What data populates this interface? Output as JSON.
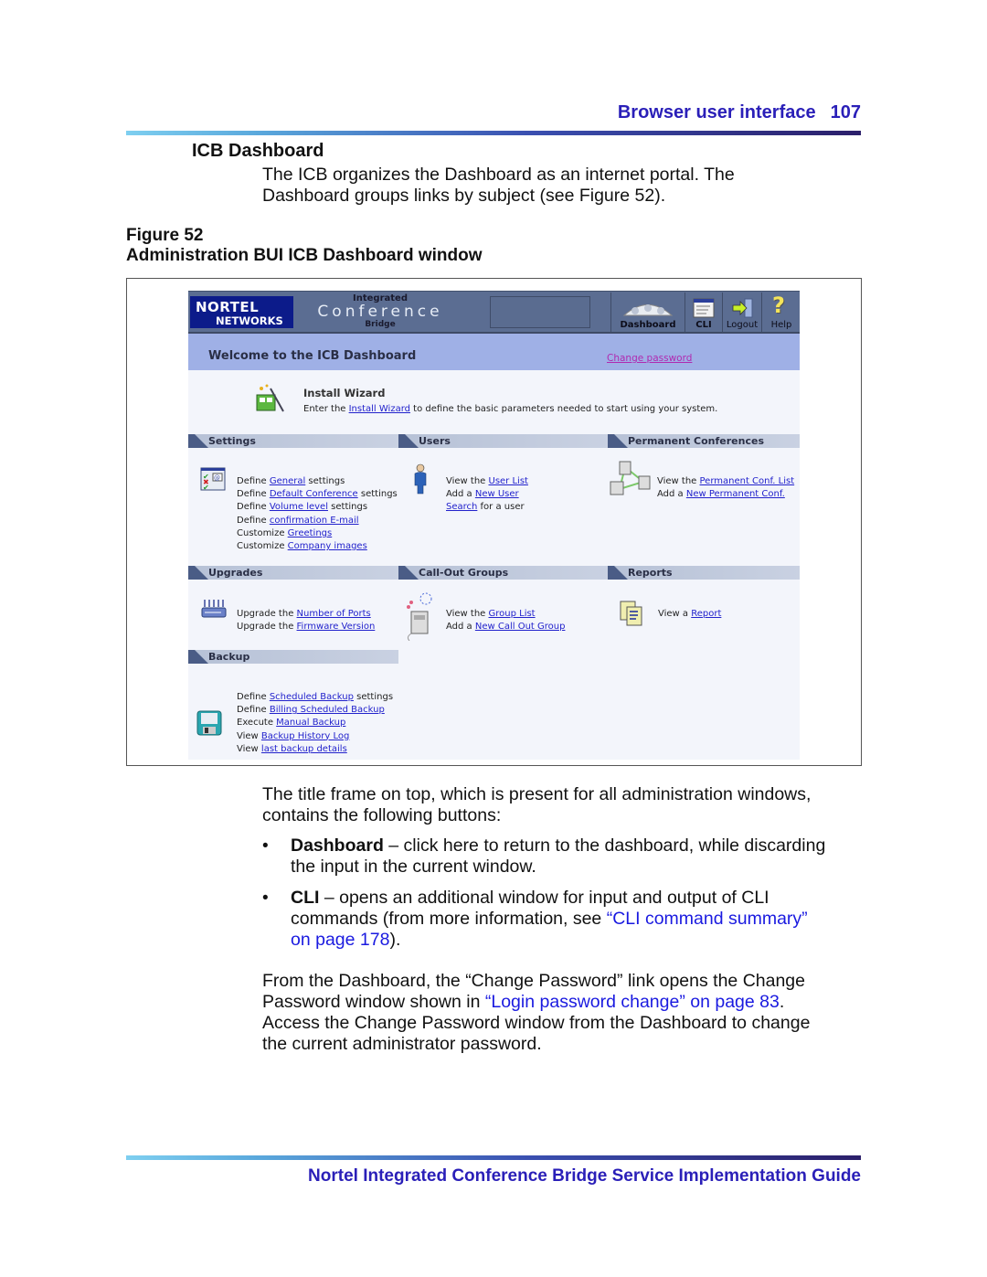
{
  "header": {
    "section": "Browser user interface",
    "page_number": "107"
  },
  "section_title": "ICB Dashboard",
  "intro_lines": [
    "The ICB organizes the Dashboard as an internet portal. The",
    "Dashboard groups links by subject (see Figure 52)."
  ],
  "figure": {
    "number": "Figure 52",
    "caption": "Administration BUI ICB Dashboard window"
  },
  "app": {
    "logo": {
      "line1": "NORTEL",
      "line2": "NETWORKS"
    },
    "product": {
      "line1": "Integrated",
      "line2": "Conference",
      "line3": "Bridge"
    },
    "toolbar": [
      {
        "label": "Dashboard",
        "icon": "dashboard-gauges-icon"
      },
      {
        "label": "CLI",
        "icon": "cli-window-icon"
      },
      {
        "label": "Logout",
        "icon": "logout-door-arrow-icon"
      },
      {
        "label": "Help",
        "icon": "help-question-icon"
      }
    ],
    "welcome": "Welcome to the ICB Dashboard",
    "change_password": "Change password",
    "wizard": {
      "title": "Install Wizard",
      "pre": "Enter the ",
      "link": "Install Wizard",
      "post": " to define the basic parameters needed to start using your system."
    },
    "sections": {
      "settings": {
        "title": "Settings",
        "items": [
          {
            "pre": "Define ",
            "link": "General",
            "post": " settings"
          },
          {
            "pre": "Define ",
            "link": "Default Conference",
            "post": " settings"
          },
          {
            "pre": "Define ",
            "link": "Volume level",
            "post": " settings"
          },
          {
            "pre": "Define ",
            "link": "confirmation E-mail",
            "post": ""
          },
          {
            "pre": "Customize ",
            "link": "Greetings",
            "post": ""
          },
          {
            "pre": "Customize ",
            "link": "Company images",
            "post": ""
          }
        ]
      },
      "users": {
        "title": "Users",
        "items": [
          {
            "pre": "View the ",
            "link": "User List",
            "post": ""
          },
          {
            "pre": "Add a ",
            "link": "New User",
            "post": ""
          },
          {
            "pre": "",
            "link": "Search",
            "post": " for a user"
          }
        ]
      },
      "permanent": {
        "title": "Permanent Conferences",
        "items": [
          {
            "pre": "View the ",
            "link": "Permanent Conf. List",
            "post": ""
          },
          {
            "pre": "Add a ",
            "link": "New Permanent Conf.",
            "post": ""
          }
        ]
      },
      "upgrades": {
        "title": "Upgrades",
        "items": [
          {
            "pre": "Upgrade the ",
            "link": "Number of Ports",
            "post": ""
          },
          {
            "pre": "Upgrade the ",
            "link": "Firmware Version",
            "post": ""
          }
        ]
      },
      "callout": {
        "title": "Call-Out Groups",
        "items": [
          {
            "pre": "View the ",
            "link": "Group List",
            "post": ""
          },
          {
            "pre": "Add a ",
            "link": "New Call Out Group",
            "post": ""
          }
        ]
      },
      "reports": {
        "title": "Reports",
        "items": [
          {
            "pre": "View a ",
            "link": "Report",
            "post": ""
          }
        ]
      },
      "backup": {
        "title": "Backup",
        "items": [
          {
            "pre": "Define ",
            "link": "Scheduled Backup",
            "post": " settings"
          },
          {
            "pre": "Define ",
            "link": "Billing Scheduled Backup",
            "post": ""
          },
          {
            "pre": "Execute ",
            "link": "Manual Backup",
            "post": ""
          },
          {
            "pre": "View ",
            "link": "Backup History Log",
            "post": ""
          },
          {
            "pre": "View ",
            "link": "last backup details",
            "post": ""
          }
        ]
      }
    }
  },
  "body": {
    "p1_lines": [
      "The title frame on top, which is present for all administration windows,",
      "contains the following buttons:"
    ],
    "bullet_char": "•",
    "b1": {
      "term": "Dashboard",
      "line1": " – click here to return to the dashboard, while discarding",
      "line2": "the input in the current window."
    },
    "b2": {
      "term": "CLI",
      "line1": " – opens an additional window for input and output of CLI",
      "line2_pre": "commands (from more information, see ",
      "line2_link": "“CLI command summary”",
      "line3_link": "on page 178",
      "line3_post": ")."
    },
    "p2": {
      "line1": "From the Dashboard, the “Change Password” link opens the Change",
      "line2_pre": "Password window shown in ",
      "line2_link": "“Login password change” on page 83",
      "line2_post": ".",
      "line3": "Access the Change Password window from the Dashboard to change",
      "line4": "the current administrator password."
    }
  },
  "footer": "Nortel Integrated Conference Bridge Service Implementation Guide",
  "colors": {
    "heading_blue": "#2a1fb8",
    "xref_blue": "#1a1ae0",
    "link_blue": "#2222cc",
    "toolbar_bg": "#5b6d92",
    "welcome_bg": "#9fb0e6"
  }
}
